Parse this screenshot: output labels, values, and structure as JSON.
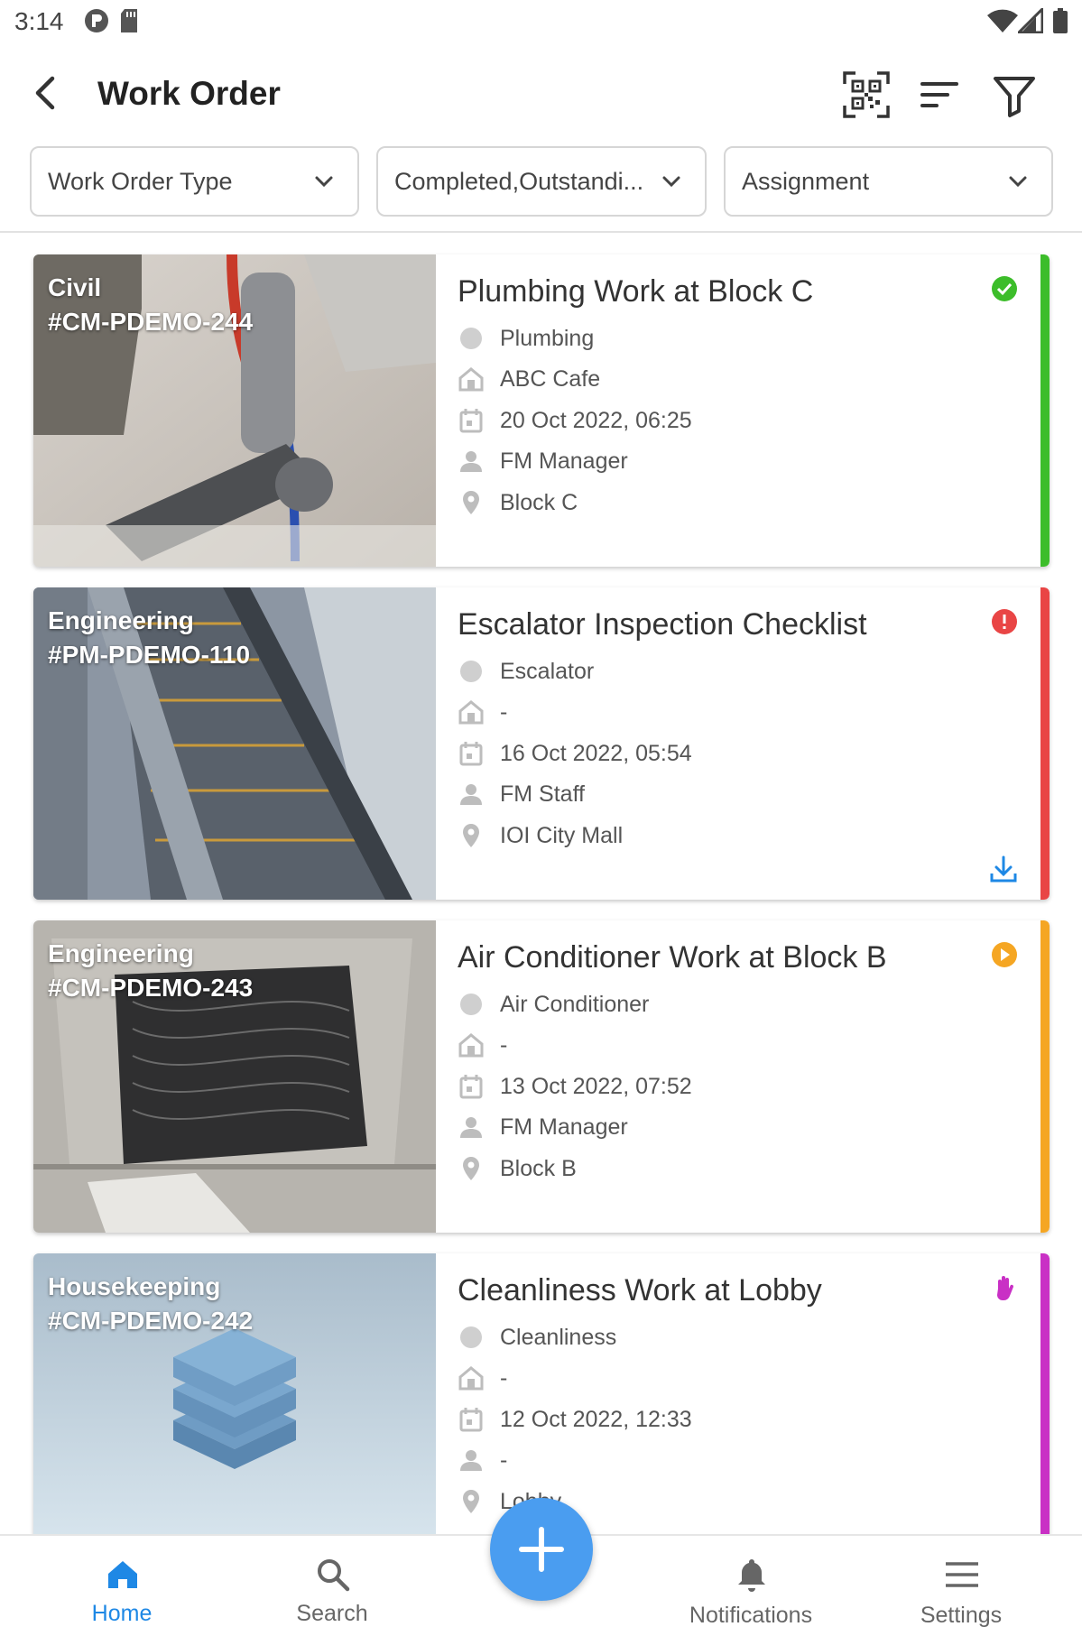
{
  "status_bar": {
    "time": "3:14"
  },
  "app_bar": {
    "title": "Work Order"
  },
  "filters": [
    {
      "label": "Work Order Type"
    },
    {
      "label": "Completed,Outstandi..."
    },
    {
      "label": "Assignment"
    }
  ],
  "work_orders": [
    {
      "category": "Civil",
      "code": "#CM-PDEMO-244",
      "title": "Plumbing Work at Block C",
      "type": "Plumbing",
      "tenant": "ABC Cafe",
      "date": "20 Oct 2022, 06:25",
      "assignee": "FM Manager",
      "location": "Block C",
      "status": "completed",
      "color": "#3cbd2a"
    },
    {
      "category": "Engineering",
      "code": "#PM-PDEMO-110",
      "title": "Escalator Inspection Checklist",
      "type": "Escalator",
      "tenant": "-",
      "date": "16 Oct 2022, 05:54",
      "assignee": "FM Staff",
      "location": "IOI City Mall",
      "status": "outstanding",
      "color": "#e94545"
    },
    {
      "category": "Engineering",
      "code": "#CM-PDEMO-243",
      "title": "Air Conditioner Work at Block B",
      "type": "Air Conditioner",
      "tenant": "-",
      "date": "13 Oct 2022, 07:52",
      "assignee": "FM Manager",
      "location": "Block B",
      "status": "in-progress",
      "color": "#f5a623"
    },
    {
      "category": "Housekeeping",
      "code": "#CM-PDEMO-242",
      "title": "Cleanliness Work at  Lobby",
      "type": "Cleanliness",
      "tenant": "-",
      "date": "12 Oct 2022, 12:33",
      "assignee": "-",
      "location": "Lobby",
      "status": "on-hold",
      "color": "#c930c5"
    }
  ],
  "bottom_nav": [
    {
      "label": "Home",
      "icon": "home-icon",
      "active": true
    },
    {
      "label": "Search",
      "icon": "search-icon"
    },
    {
      "label": "Notifications",
      "icon": "bell-icon"
    },
    {
      "label": "Settings",
      "icon": "menu-icon"
    }
  ],
  "colors": {
    "accent": "#1e88e5",
    "fab": "#4a9df0"
  }
}
